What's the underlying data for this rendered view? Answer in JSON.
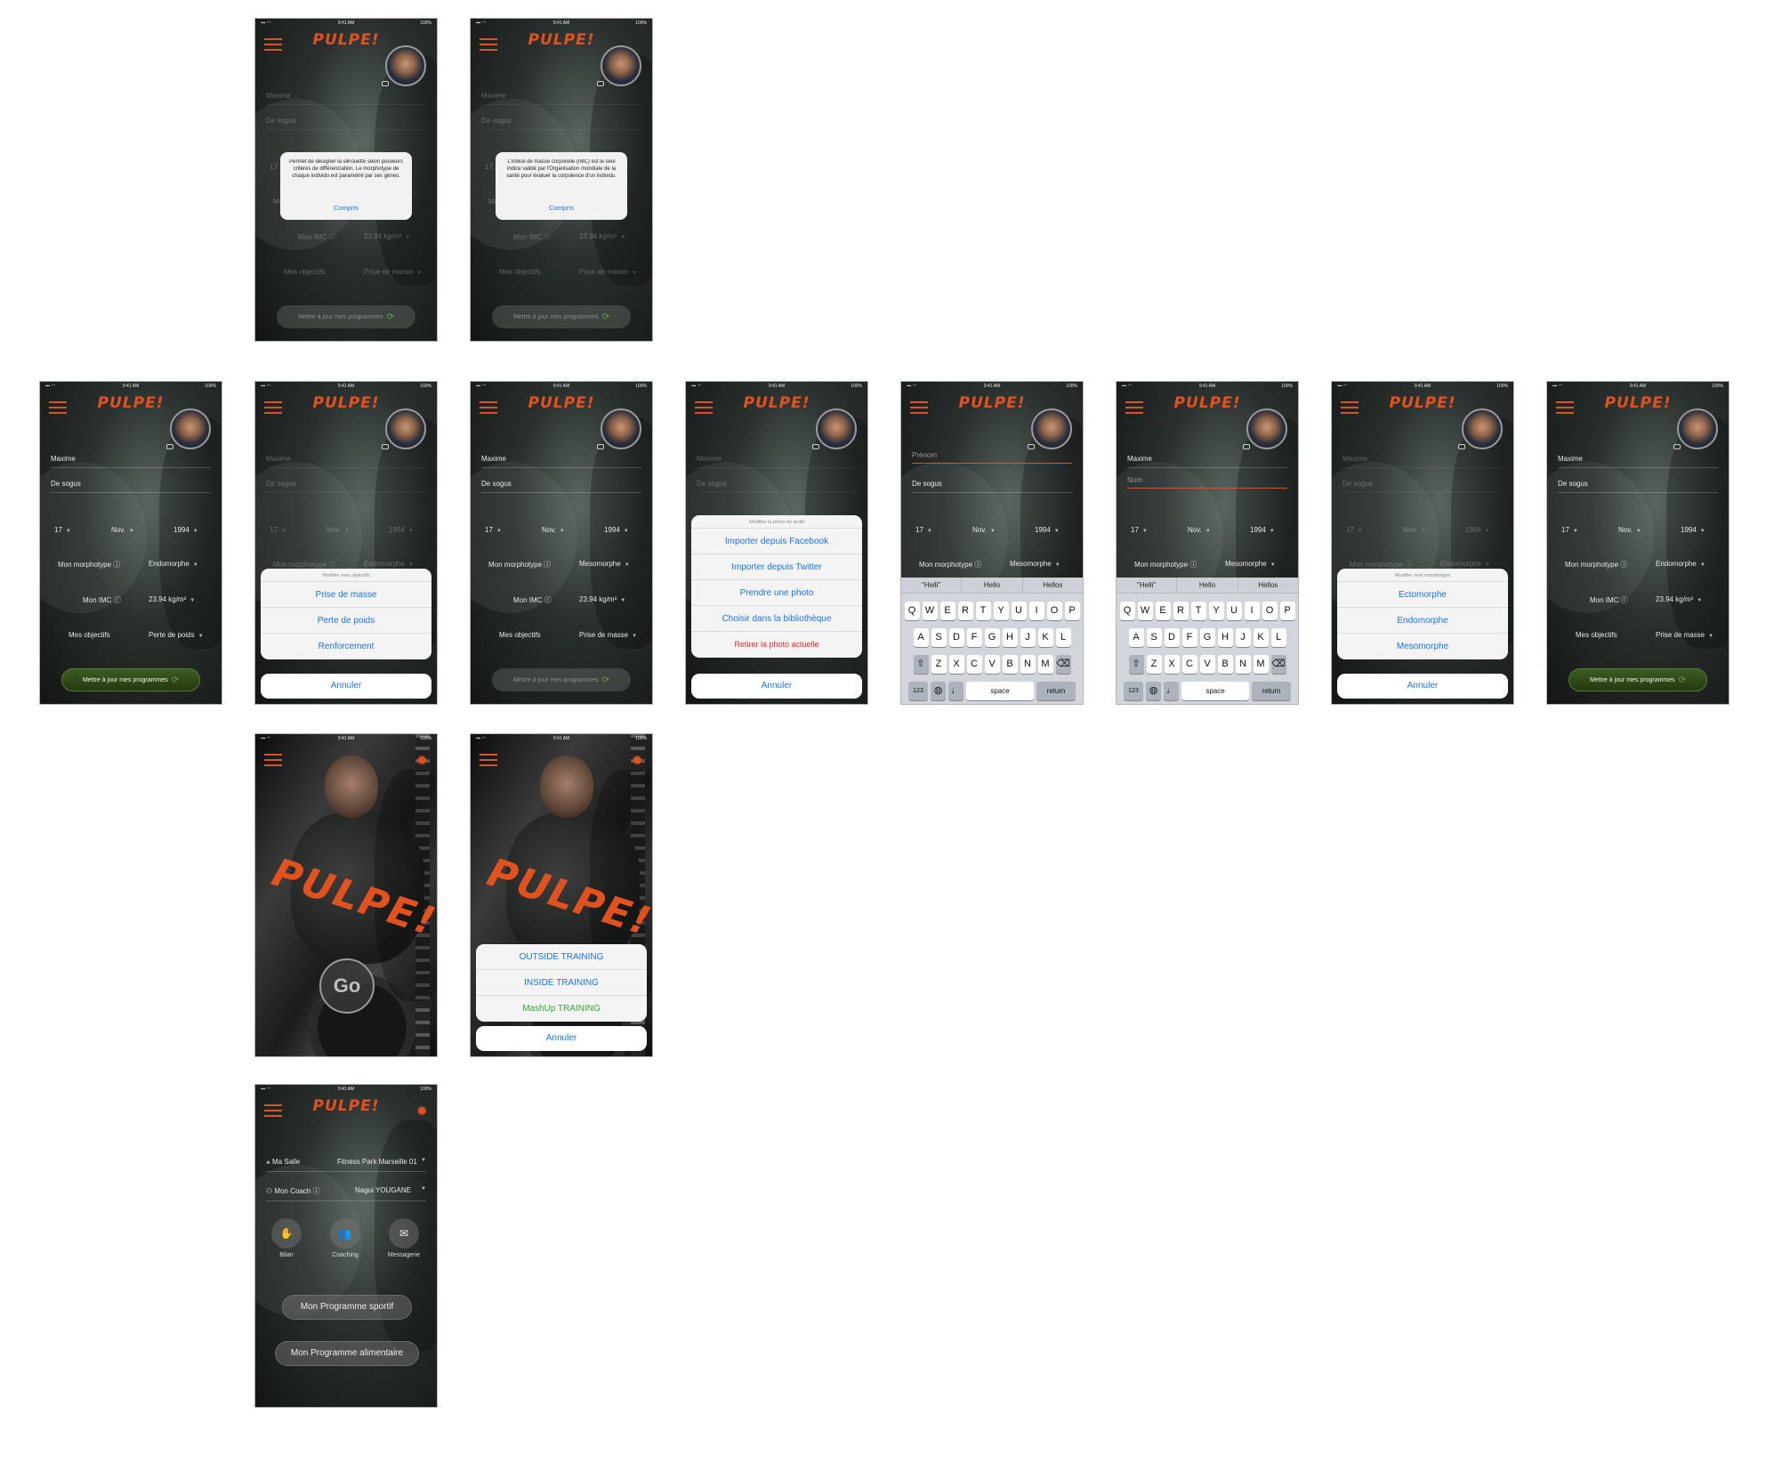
{
  "status": {
    "time": "9:41 AM",
    "battery": "100%",
    "signal": "▪▪▪ ◠"
  },
  "app": {
    "logo": "PULPE!",
    "accent": "#e2521f"
  },
  "profile": {
    "first_name": "Maxime",
    "last_name": "De sogus",
    "day": "17",
    "month": "Nov.",
    "year": "1994",
    "morpho_label": "Mon morphotype",
    "morpho_endo": "Endomorphe",
    "morpho_meso": "Mesomorphe",
    "imc_label": "Mon IMC",
    "imc_value": "23.94 kg/m²",
    "goal_label": "Mes objectifs",
    "goal_mass": "Prise de masse",
    "goal_loss": "Perte de poids",
    "update_btn": "Mettre à jour mes programmes",
    "firstname_placeholder": "Prénom",
    "lastname_placeholder": "Nom"
  },
  "alerts": {
    "morpho": "Permet de désigner la silhouette selon plusieurs critères de différenciation. Le morphotype de chaque individu est paramétré par ses gènes.",
    "imc": "L'indice de masse corporelle (IMC) est le seul indice validé par l'Organisation mondiale de la santé pour évaluer la corpulence d'un individu.",
    "ok": "Compris"
  },
  "sheets": {
    "cancel": "Annuler",
    "objectives": {
      "title": "Modifier mes objectifs",
      "options": [
        "Prise de masse",
        "Perte de poids",
        "Renforcement"
      ]
    },
    "photo": {
      "title": "Modifier la photo de profil",
      "options": [
        "Importer depuis Facebook",
        "Importer depuis Twitter",
        "Prendre une photo",
        "Choisir dans la bibliothèque"
      ],
      "remove": "Retirer la photo actuelle"
    },
    "morpho": {
      "title": "Modifier mon morphotype",
      "options": [
        "Ectomorphe",
        "Endomorphe",
        "Mesomorphe"
      ]
    },
    "training": {
      "options": [
        "OUTSIDE TRAINING",
        "INSIDE TRAINING",
        "MashUp TRAINING"
      ],
      "colors": [
        "#1a73e8",
        "#1a73e8",
        "#3aa33a"
      ]
    }
  },
  "keyboard": {
    "suggestions": [
      "\"Helli\"",
      "Hello",
      "Hellos"
    ],
    "row1": [
      "Q",
      "W",
      "E",
      "R",
      "T",
      "Y",
      "U",
      "I",
      "O",
      "P"
    ],
    "row2": [
      "A",
      "S",
      "D",
      "F",
      "G",
      "H",
      "J",
      "K",
      "L"
    ],
    "row3": [
      "Z",
      "X",
      "C",
      "V",
      "B",
      "N",
      "M"
    ],
    "num": "123",
    "space": "space",
    "ret": "return"
  },
  "splash": {
    "logo": "PULPE!",
    "go": "Go"
  },
  "home": {
    "gym_label": "Ma Salle",
    "gym_value": "Fitness Park Marseille 01",
    "coach_label": "Mon Coach",
    "coach_value": "Nagui YOUGANE",
    "bilan": "Bilan",
    "coaching": "Coaching",
    "messagerie": "Messagerie",
    "program_sport": "Mon Programme sportif",
    "program_food": "Mon Programme alimentaire"
  }
}
